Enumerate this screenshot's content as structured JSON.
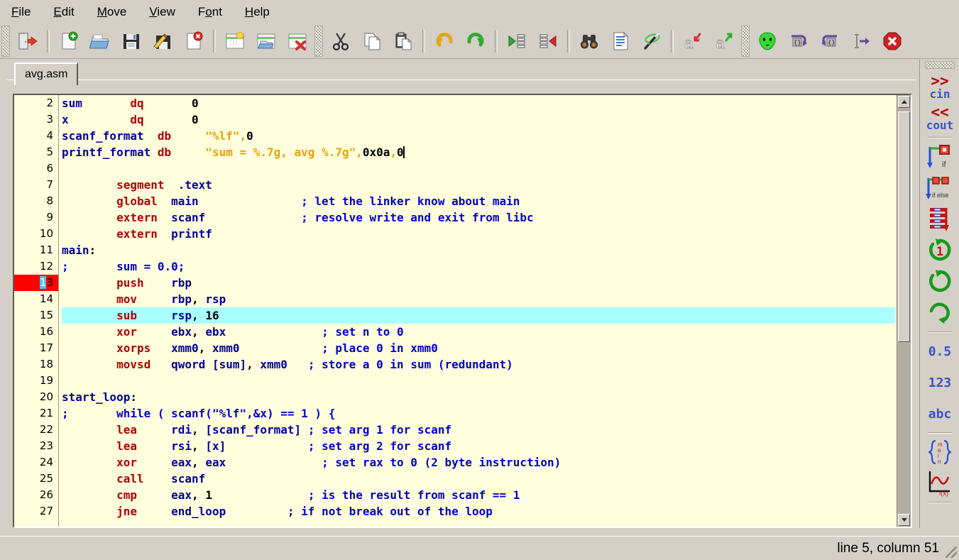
{
  "window": {
    "title": "avg.asm",
    "status_text": "line 5, column 51"
  },
  "menubar": {
    "items": [
      {
        "name": "file",
        "mnemonic": "F",
        "rest": "ile"
      },
      {
        "name": "edit",
        "mnemonic": "E",
        "rest": "dit"
      },
      {
        "name": "move",
        "mnemonic": "M",
        "rest": "ove"
      },
      {
        "name": "view",
        "mnemonic": "V",
        "rest": "iew"
      },
      {
        "name": "font",
        "pre": "F",
        "mnemonic": "o",
        "rest": "nt"
      },
      {
        "name": "help",
        "mnemonic": "H",
        "rest": "elp"
      }
    ]
  },
  "toolbar": {
    "buttons": [
      {
        "icon": "exit-door-icon",
        "tip": "Exit"
      },
      {
        "icon": "new-file-icon",
        "tip": "New file"
      },
      {
        "icon": "open-file-icon",
        "tip": "Open file"
      },
      {
        "icon": "save-file-icon",
        "tip": "Save"
      },
      {
        "icon": "save-as-icon",
        "tip": "Save as"
      },
      {
        "icon": "close-file-icon",
        "tip": "Close file"
      },
      {
        "icon": "new-window-icon",
        "tip": "New window"
      },
      {
        "icon": "open-window-icon",
        "tip": "Open window"
      },
      {
        "icon": "close-window-icon",
        "tip": "Close window"
      },
      {
        "icon": "cut-icon",
        "tip": "Cut"
      },
      {
        "icon": "copy-icon",
        "tip": "Copy"
      },
      {
        "icon": "paste-icon",
        "tip": "Paste"
      },
      {
        "icon": "undo-icon",
        "tip": "Undo"
      },
      {
        "icon": "redo-icon",
        "tip": "Redo"
      },
      {
        "icon": "indent-icon",
        "tip": "Indent"
      },
      {
        "icon": "outdent-icon",
        "tip": "Outdent"
      },
      {
        "icon": "find-binoculars-icon",
        "tip": "Find"
      },
      {
        "icon": "document-lines-icon",
        "tip": "Document"
      },
      {
        "icon": "magic-wand-icon",
        "tip": "Auto format"
      },
      {
        "icon": "font-decrease-icon",
        "tip": "Decrease font"
      },
      {
        "icon": "font-increase-icon",
        "tip": "Increase font"
      },
      {
        "icon": "alien-icon",
        "tip": "Run"
      },
      {
        "icon": "brace-forward-icon",
        "tip": "Next block"
      },
      {
        "icon": "brace-back-icon",
        "tip": "Previous block"
      },
      {
        "icon": "goto-line-icon",
        "tip": "Go to"
      },
      {
        "icon": "stop-icon",
        "tip": "Stop"
      }
    ]
  },
  "sidebar": {
    "items": [
      {
        "name": "cin-snippet",
        "glyph": ">>",
        "label": "cin",
        "kind": "text"
      },
      {
        "name": "cout-snippet",
        "glyph": "<<",
        "label": "cout",
        "kind": "text"
      },
      {
        "name": "if-snippet",
        "label": "if",
        "kind": "icon"
      },
      {
        "name": "ifelse-snippet",
        "label": "if else",
        "kind": "icon"
      },
      {
        "name": "switch-snippet",
        "label": "",
        "kind": "icon"
      },
      {
        "name": "do-while-snippet",
        "label": "1",
        "kind": "icon"
      },
      {
        "name": "while-snippet",
        "label": "",
        "kind": "icon"
      },
      {
        "name": "for-snippet",
        "label": "",
        "kind": "icon"
      },
      {
        "name": "float-snippet",
        "label": "0.5",
        "kind": "label"
      },
      {
        "name": "int-snippet",
        "label": "123",
        "kind": "label"
      },
      {
        "name": "string-snippet",
        "label": "abc",
        "kind": "label"
      },
      {
        "name": "main-snippet",
        "label": "main",
        "kind": "icon"
      },
      {
        "name": "function-snippet",
        "label": "f(x)",
        "kind": "icon"
      }
    ]
  },
  "editor": {
    "first_visible_line": 2,
    "cursor_line": 13,
    "highlighted_line": 15,
    "breakpoint_line": 13,
    "caret_row_index": 3,
    "lines": [
      {
        "n": 2,
        "tokens": [
          {
            "t": "sum",
            "c": "id"
          },
          {
            "t": "       ",
            "c": "num"
          },
          {
            "t": "dq",
            "c": "k"
          },
          {
            "t": "       ",
            "c": "num"
          },
          {
            "t": "0",
            "c": "num"
          }
        ]
      },
      {
        "n": 3,
        "tokens": [
          {
            "t": "x",
            "c": "id"
          },
          {
            "t": "         ",
            "c": "num"
          },
          {
            "t": "dq",
            "c": "k"
          },
          {
            "t": "       ",
            "c": "num"
          },
          {
            "t": "0",
            "c": "num"
          }
        ]
      },
      {
        "n": 4,
        "tokens": [
          {
            "t": "scanf_format",
            "c": "id"
          },
          {
            "t": "  ",
            "c": "num"
          },
          {
            "t": "db",
            "c": "k"
          },
          {
            "t": "     ",
            "c": "num"
          },
          {
            "t": "\"%lf\"",
            "c": "st"
          },
          {
            "t": ",",
            "c": "st"
          },
          {
            "t": "0",
            "c": "num"
          }
        ]
      },
      {
        "n": 5,
        "tokens": [
          {
            "t": "printf_format",
            "c": "id"
          },
          {
            "t": " ",
            "c": "num"
          },
          {
            "t": "db",
            "c": "k"
          },
          {
            "t": "     ",
            "c": "num"
          },
          {
            "t": "\"sum = %.7g, avg %.7g\"",
            "c": "st"
          },
          {
            "t": ",",
            "c": "st"
          },
          {
            "t": "0x0a",
            "c": "num"
          },
          {
            "t": ",",
            "c": "st"
          },
          {
            "t": "0",
            "c": "num"
          }
        ],
        "caret": true
      },
      {
        "n": 6,
        "tokens": []
      },
      {
        "n": 7,
        "tokens": [
          {
            "t": "        ",
            "c": "num"
          },
          {
            "t": "segment",
            "c": "k"
          },
          {
            "t": "  ",
            "c": "num"
          },
          {
            "t": ".text",
            "c": "id"
          }
        ]
      },
      {
        "n": 8,
        "tokens": [
          {
            "t": "        ",
            "c": "num"
          },
          {
            "t": "global",
            "c": "k"
          },
          {
            "t": "  ",
            "c": "num"
          },
          {
            "t": "main",
            "c": "id"
          },
          {
            "t": "               ",
            "c": "num"
          },
          {
            "t": "; let the linker know about main",
            "c": "cm"
          }
        ]
      },
      {
        "n": 9,
        "tokens": [
          {
            "t": "        ",
            "c": "num"
          },
          {
            "t": "extern",
            "c": "k"
          },
          {
            "t": "  ",
            "c": "num"
          },
          {
            "t": "scanf",
            "c": "id"
          },
          {
            "t": "              ",
            "c": "num"
          },
          {
            "t": "; resolve write and exit from libc",
            "c": "cm"
          }
        ]
      },
      {
        "n": 10,
        "tokens": [
          {
            "t": "        ",
            "c": "num"
          },
          {
            "t": "extern",
            "c": "k"
          },
          {
            "t": "  ",
            "c": "num"
          },
          {
            "t": "printf",
            "c": "id"
          }
        ]
      },
      {
        "n": 11,
        "tokens": [
          {
            "t": "main",
            "c": "id"
          },
          {
            "t": ":",
            "c": "num"
          }
        ]
      },
      {
        "n": 12,
        "tokens": [
          {
            "t": ";",
            "c": "cm"
          },
          {
            "t": "       ",
            "c": "num"
          },
          {
            "t": "sum = 0.0;",
            "c": "cm"
          }
        ]
      },
      {
        "n": 13,
        "tokens": [
          {
            "t": "        ",
            "c": "num"
          },
          {
            "t": "push",
            "c": "k"
          },
          {
            "t": "    ",
            "c": "num"
          },
          {
            "t": "rbp",
            "c": "id"
          }
        ]
      },
      {
        "n": 14,
        "tokens": [
          {
            "t": "        ",
            "c": "num"
          },
          {
            "t": "mov",
            "c": "k"
          },
          {
            "t": "     ",
            "c": "num"
          },
          {
            "t": "rbp",
            "c": "id"
          },
          {
            "t": ", ",
            "c": "num"
          },
          {
            "t": "rsp",
            "c": "id"
          }
        ]
      },
      {
        "n": 15,
        "tokens": [
          {
            "t": "        ",
            "c": "num"
          },
          {
            "t": "sub",
            "c": "k"
          },
          {
            "t": "     ",
            "c": "num"
          },
          {
            "t": "rsp",
            "c": "id"
          },
          {
            "t": ", ",
            "c": "num"
          },
          {
            "t": "16",
            "c": "num"
          }
        ]
      },
      {
        "n": 16,
        "tokens": [
          {
            "t": "        ",
            "c": "num"
          },
          {
            "t": "xor",
            "c": "k"
          },
          {
            "t": "     ",
            "c": "num"
          },
          {
            "t": "ebx",
            "c": "id"
          },
          {
            "t": ", ",
            "c": "num"
          },
          {
            "t": "ebx",
            "c": "id"
          },
          {
            "t": "              ",
            "c": "num"
          },
          {
            "t": "; set n to 0",
            "c": "cm"
          }
        ]
      },
      {
        "n": 17,
        "tokens": [
          {
            "t": "        ",
            "c": "num"
          },
          {
            "t": "xorps",
            "c": "k"
          },
          {
            "t": "   ",
            "c": "num"
          },
          {
            "t": "xmm0",
            "c": "id"
          },
          {
            "t": ", ",
            "c": "num"
          },
          {
            "t": "xmm0",
            "c": "id"
          },
          {
            "t": "            ",
            "c": "num"
          },
          {
            "t": "; place 0 in xmm0",
            "c": "cm"
          }
        ]
      },
      {
        "n": 18,
        "tokens": [
          {
            "t": "        ",
            "c": "num"
          },
          {
            "t": "movsd",
            "c": "k"
          },
          {
            "t": "   ",
            "c": "num"
          },
          {
            "t": "qword",
            "c": "id"
          },
          {
            "t": " ",
            "c": "num"
          },
          {
            "t": "[sum]",
            "c": "id"
          },
          {
            "t": ", ",
            "c": "num"
          },
          {
            "t": "xmm0",
            "c": "id"
          },
          {
            "t": "   ",
            "c": "num"
          },
          {
            "t": "; store a 0 in sum (redundant)",
            "c": "cm"
          }
        ]
      },
      {
        "n": 19,
        "tokens": []
      },
      {
        "n": 20,
        "tokens": [
          {
            "t": "start_loop",
            "c": "id"
          },
          {
            "t": ":",
            "c": "num"
          }
        ]
      },
      {
        "n": 21,
        "tokens": [
          {
            "t": ";",
            "c": "cm"
          },
          {
            "t": "       ",
            "c": "num"
          },
          {
            "t": "while ( scanf(\"%lf\",&x) == 1 ) {",
            "c": "cm"
          }
        ]
      },
      {
        "n": 22,
        "tokens": [
          {
            "t": "        ",
            "c": "num"
          },
          {
            "t": "lea",
            "c": "k"
          },
          {
            "t": "     ",
            "c": "num"
          },
          {
            "t": "rdi",
            "c": "id"
          },
          {
            "t": ", ",
            "c": "num"
          },
          {
            "t": "[scanf_format]",
            "c": "id"
          },
          {
            "t": " ",
            "c": "num"
          },
          {
            "t": "; set arg 1 for scanf",
            "c": "cm"
          }
        ]
      },
      {
        "n": 23,
        "tokens": [
          {
            "t": "        ",
            "c": "num"
          },
          {
            "t": "lea",
            "c": "k"
          },
          {
            "t": "     ",
            "c": "num"
          },
          {
            "t": "rsi",
            "c": "id"
          },
          {
            "t": ", ",
            "c": "num"
          },
          {
            "t": "[x]",
            "c": "id"
          },
          {
            "t": "            ",
            "c": "num"
          },
          {
            "t": "; set arg 2 for scanf",
            "c": "cm"
          }
        ]
      },
      {
        "n": 24,
        "tokens": [
          {
            "t": "        ",
            "c": "num"
          },
          {
            "t": "xor",
            "c": "k"
          },
          {
            "t": "     ",
            "c": "num"
          },
          {
            "t": "eax",
            "c": "id"
          },
          {
            "t": ", ",
            "c": "num"
          },
          {
            "t": "eax",
            "c": "id"
          },
          {
            "t": "              ",
            "c": "num"
          },
          {
            "t": "; set rax to 0 (2 byte instruction)",
            "c": "cm"
          }
        ]
      },
      {
        "n": 25,
        "tokens": [
          {
            "t": "        ",
            "c": "num"
          },
          {
            "t": "call",
            "c": "k"
          },
          {
            "t": "    ",
            "c": "num"
          },
          {
            "t": "scanf",
            "c": "id"
          }
        ]
      },
      {
        "n": 26,
        "tokens": [
          {
            "t": "        ",
            "c": "num"
          },
          {
            "t": "cmp",
            "c": "k"
          },
          {
            "t": "     ",
            "c": "num"
          },
          {
            "t": "eax",
            "c": "id"
          },
          {
            "t": ", ",
            "c": "num"
          },
          {
            "t": "1",
            "c": "num"
          },
          {
            "t": "              ",
            "c": "num"
          },
          {
            "t": "; is the result from scanf == 1",
            "c": "cm"
          }
        ]
      },
      {
        "n": 27,
        "tokens": [
          {
            "t": "        ",
            "c": "num"
          },
          {
            "t": "jne",
            "c": "k"
          },
          {
            "t": "     ",
            "c": "num"
          },
          {
            "t": "end_loop",
            "c": "id"
          },
          {
            "t": "         ",
            "c": "num"
          },
          {
            "t": "; if not break out of the loop",
            "c": "cm"
          }
        ]
      }
    ]
  },
  "colors": {
    "editor_bg": "#ffffdd",
    "keyword": "#b00000",
    "identifier": "#000099",
    "string": "#e8a200",
    "comment": "#0000cc",
    "highlight_line": "#aaffff",
    "breakpoint": "#ff0000",
    "chrome": "#d4d0c8"
  }
}
